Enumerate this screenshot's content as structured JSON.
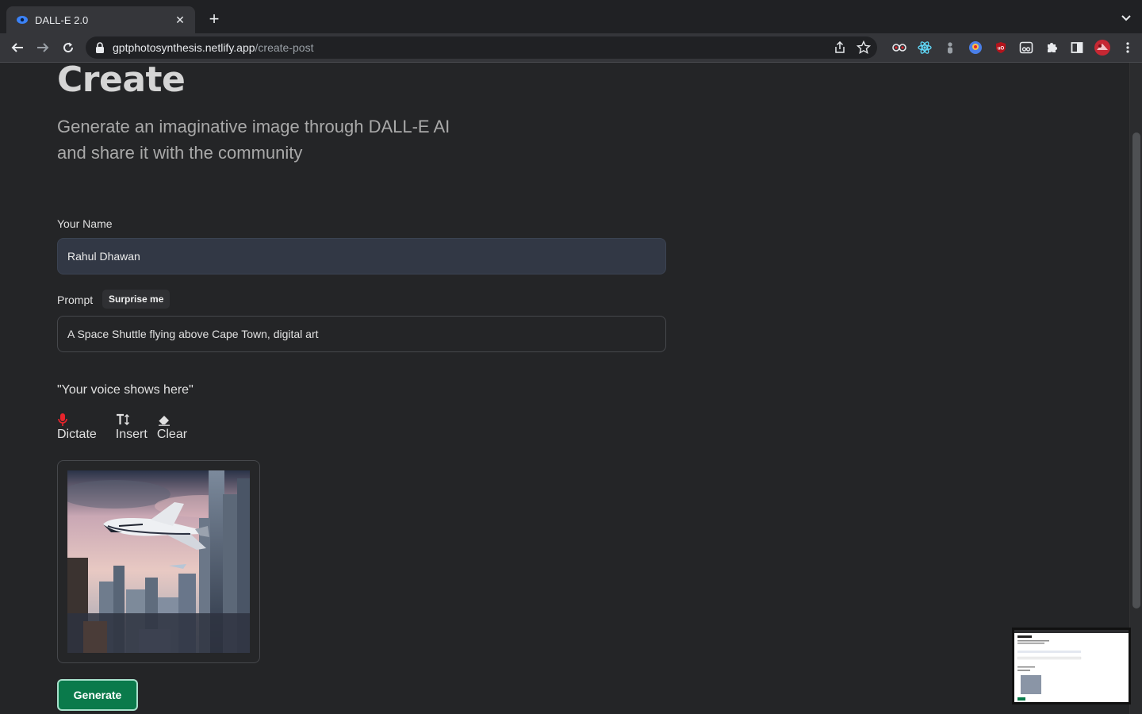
{
  "browser": {
    "tab_title": "DALL-E 2.0",
    "url_host": "gptphotosynthesis.netlify.app",
    "url_path": "/create-post",
    "extensions": [
      "glasses-extension-icon",
      "react-devtools-icon",
      "person-extension-icon",
      "shield-extension-icon",
      "ublock-icon",
      "frame-extension-icon",
      "puzzle-icon",
      "side-panel-icon",
      "profile-avatar",
      "more-menu-icon"
    ]
  },
  "page": {
    "title": "Create",
    "subtitle": "Generate an imaginative image through DALL-E AI and share it with the community"
  },
  "form": {
    "name_label": "Your Name",
    "name_value": "Rahul Dhawan",
    "prompt_label": "Prompt",
    "surprise_label": "Surprise me",
    "prompt_value": "A Space Shuttle flying above Cape Town, digital art",
    "voice_text": "\"Your voice shows here\"",
    "voice_actions": [
      "Dictate",
      "Insert",
      "Clear"
    ],
    "generate_label": "Generate"
  },
  "colors": {
    "accent_green": "#0a7a4b",
    "mic_red": "#e8242c",
    "background": "#242527"
  }
}
